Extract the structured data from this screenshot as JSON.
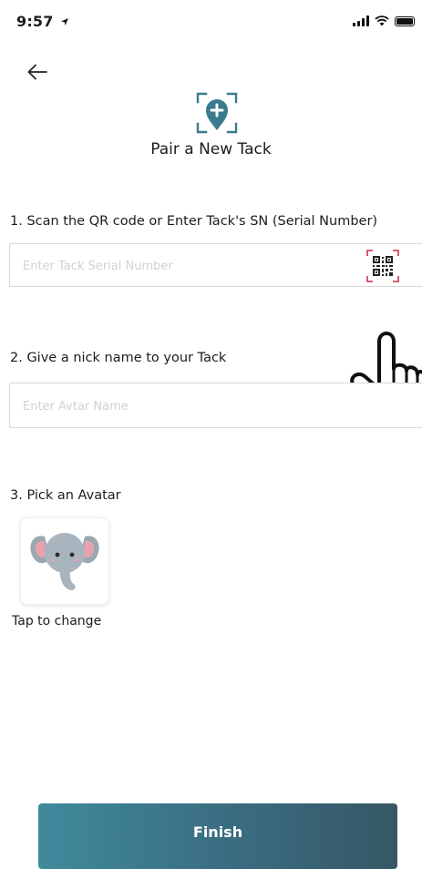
{
  "status_bar": {
    "time": "9:57"
  },
  "header": {
    "title": "Pair a New Tack"
  },
  "step1": {
    "label": "1. Scan the QR code or Enter Tack's SN (Serial Number)",
    "placeholder": "Enter Tack Serial Number",
    "value": ""
  },
  "step2": {
    "label": "2. Give a nick name to your Tack",
    "placeholder": "Enter Avtar Name",
    "value": ""
  },
  "step3": {
    "label": "3. Pick an Avatar",
    "avatar": "elephant-avatar",
    "hint": "Tap to change"
  },
  "footer": {
    "finish_label": "Finish"
  },
  "colors": {
    "accent": "#3b7a8c",
    "qr_corner": "#d04a5a",
    "finish_start": "#3f8a9c",
    "finish_end": "#365766"
  }
}
